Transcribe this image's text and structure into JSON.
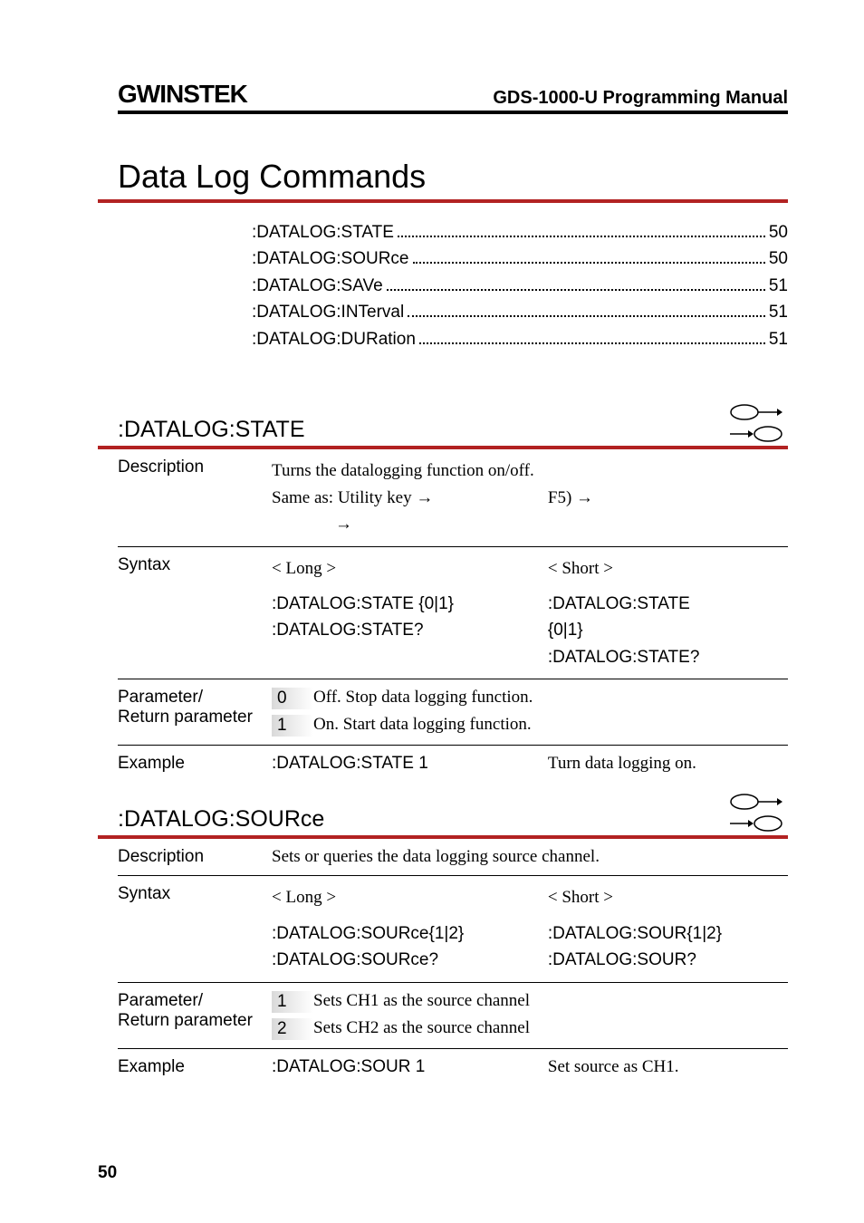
{
  "header": {
    "logo": "GWINSTEK",
    "manual": "GDS-1000-U Programming Manual"
  },
  "section_title": "Data Log Commands",
  "toc": [
    {
      "label": ":DATALOG:STATE",
      "page": "50"
    },
    {
      "label": ":DATALOG:SOURce",
      "page": "50"
    },
    {
      "label": ":DATALOG:SAVe",
      "page": "51"
    },
    {
      "label": ":DATALOG:INTerval",
      "page": "51"
    },
    {
      "label": ":DATALOG:DURation",
      "page": "51"
    }
  ],
  "cmd1": {
    "name": ":DATALOG:STATE",
    "desc_line1": "Turns the datalogging function on/off.",
    "desc_line2a": "Same as: Utility key →",
    "desc_line2b": "F5) →",
    "desc_line3": "→",
    "long_label": "< Long >",
    "short_label": "< Short >",
    "long_cmd1": ":DATALOG:STATE {0|1}",
    "long_cmd2": ":DATALOG:STATE?",
    "short_cmd1": ":DATALOG:STATE",
    "short_cmd2": "{0|1}",
    "short_cmd3": ":DATALOG:STATE?",
    "param_label": "Parameter/",
    "param_label2": "Return parameter",
    "p0": "0",
    "p0d": "Off. Stop data logging function.",
    "p1": "1",
    "p1d": "On. Start data logging function.",
    "ex_label": "Example",
    "ex_cmd": ":DATALOG:STATE 1",
    "ex_desc": "Turn data logging on."
  },
  "cmd2": {
    "name": ":DATALOG:SOURce",
    "desc": "Sets or queries the data logging source channel.",
    "long_label": "< Long >",
    "short_label": "< Short >",
    "long_cmd1": ":DATALOG:SOURce{1|2}",
    "long_cmd2": ":DATALOG:SOURce?",
    "short_cmd1": ":DATALOG:SOUR{1|2}",
    "short_cmd2": ":DATALOG:SOUR?",
    "param_label": "Parameter/",
    "param_label2": "Return parameter",
    "p1": "1",
    "p1d": "Sets CH1 as the source channel",
    "p2": "2",
    "p2d": "Sets CH2 as the source channel",
    "ex_label": "Example",
    "ex_cmd": ":DATALOG:SOUR 1",
    "ex_desc": "Set source as CH1."
  },
  "labels": {
    "description": "Description",
    "syntax": "Syntax"
  },
  "page_number": "50"
}
